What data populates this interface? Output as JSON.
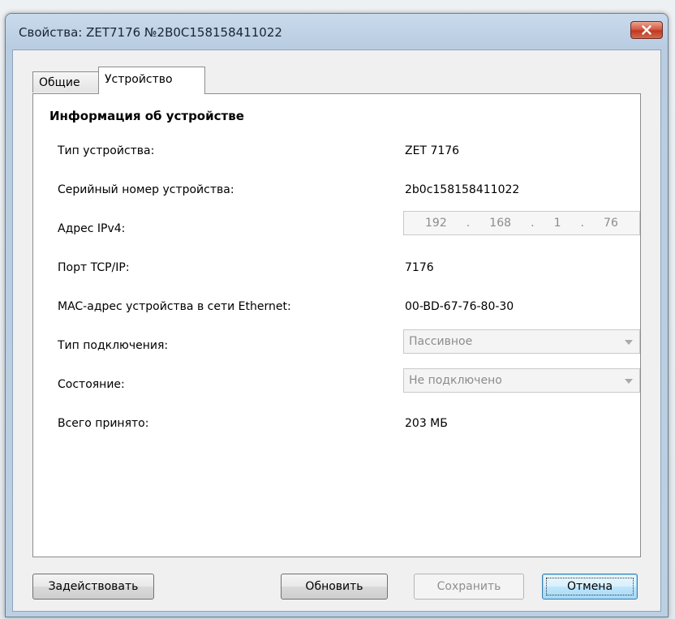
{
  "window": {
    "title": "Свойства: ZET7176 №2B0C158158411022"
  },
  "tabs": [
    {
      "label": "Общие",
      "active": false
    },
    {
      "label": "Устройство",
      "active": true
    }
  ],
  "section": {
    "title": "Информация об устройстве"
  },
  "fields": {
    "device_type": {
      "label": "Тип устройства:",
      "value": "ZET 7176"
    },
    "serial": {
      "label": "Серийный номер устройства:",
      "value": "2b0c158158411022"
    },
    "ipv4": {
      "label": "Адрес IPv4:",
      "octets": [
        "192",
        "168",
        "1",
        "76"
      ]
    },
    "port": {
      "label": "Порт TCP/IP:",
      "value": "7176"
    },
    "mac": {
      "label": "MAC-адрес устройства в сети Ethernet:",
      "value": "00-BD-67-76-80-30"
    },
    "connection_type": {
      "label": "Тип подключения:",
      "selected": "Пассивное"
    },
    "state": {
      "label": "Состояние:",
      "selected": "Не подключено"
    },
    "total_received": {
      "label": "Всего принято:",
      "value": "203 МБ"
    }
  },
  "buttons": {
    "activate": "Задействовать",
    "refresh": "Обновить",
    "save": "Сохранить",
    "cancel": "Отмена"
  },
  "colors": {
    "window_frame": "#bcd0e4",
    "close_button": "#c1381f",
    "default_button": "#3c7fb1"
  }
}
